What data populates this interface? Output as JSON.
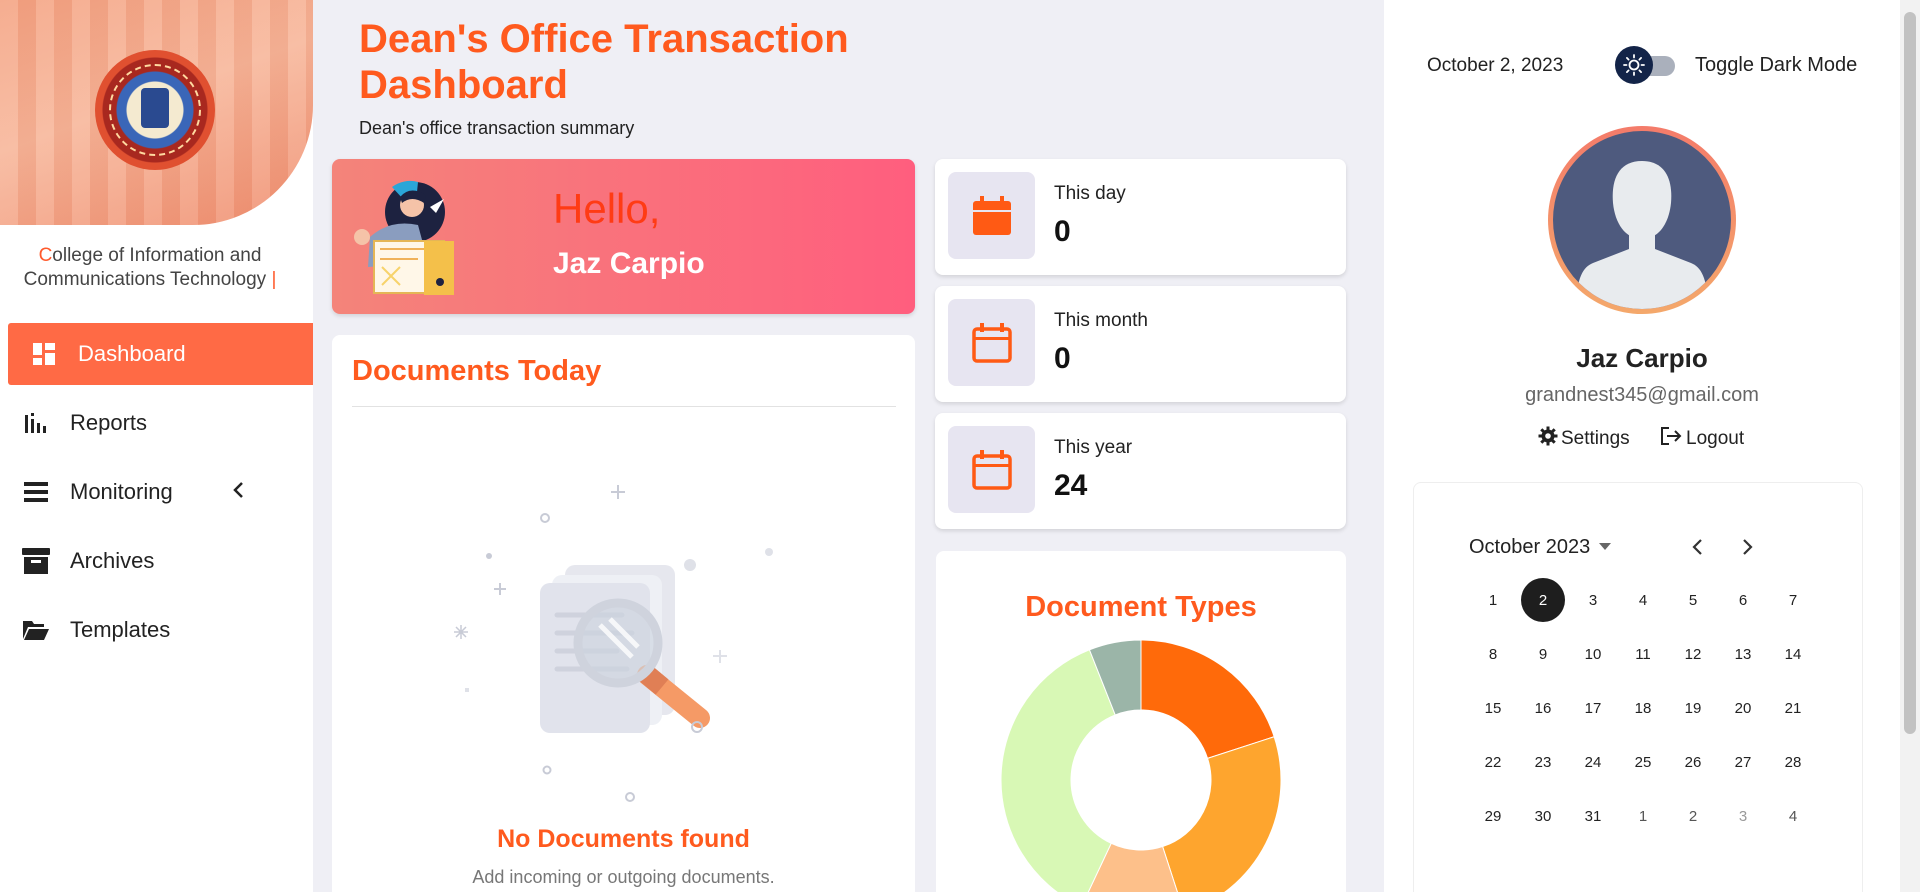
{
  "sidebar": {
    "college_first_letter": "C",
    "college_rest_line1": "ollege of Information and",
    "college_line2": "Communications Technology",
    "caret": "|",
    "nav": [
      {
        "label": "Dashboard",
        "icon": "dashboard-icon",
        "active": true
      },
      {
        "label": "Reports",
        "icon": "bar-chart-icon"
      },
      {
        "label": "Monitoring",
        "icon": "list-icon"
      },
      {
        "label": "Archives",
        "icon": "archive-icon"
      },
      {
        "label": "Templates",
        "icon": "folder-open-icon"
      }
    ]
  },
  "header": {
    "title": "Dean's Office Transaction Dashboard",
    "subtitle": "Dean's office transaction summary"
  },
  "hello": {
    "greeting": "Hello,",
    "name": "Jaz Carpio"
  },
  "documents_today": {
    "title": "Documents Today",
    "empty_title": "No Documents found",
    "empty_subtitle": "Add incoming or outgoing documents."
  },
  "stats": [
    {
      "label": "This day",
      "value": "0"
    },
    {
      "label": "This month",
      "value": "0"
    },
    {
      "label": "This year",
      "value": "24"
    }
  ],
  "document_types": {
    "title": "Document Types"
  },
  "chart_data": {
    "type": "pie",
    "title": "Document Types",
    "donut": true,
    "slices": [
      {
        "value": 20,
        "color": "#ff6a0a"
      },
      {
        "value": 25,
        "color": "#fea52e"
      },
      {
        "value": 12,
        "color": "#fdc08a"
      },
      {
        "value": 37,
        "color": "#d8f8b5"
      },
      {
        "value": 6,
        "color": "#9bb5a8"
      }
    ]
  },
  "right_panel": {
    "date": "October 2, 2023",
    "toggle_label": "Toggle Dark Mode",
    "profile_name": "Jaz Carpio",
    "profile_email": "grandnest345@gmail.com",
    "settings_label": "Settings",
    "logout_label": "Logout"
  },
  "calendar": {
    "month_label": "October 2023",
    "selected_day": "2",
    "weeks": [
      [
        "1",
        "2",
        "3",
        "4",
        "5",
        "6",
        "7"
      ],
      [
        "8",
        "9",
        "10",
        "11",
        "12",
        "13",
        "14"
      ],
      [
        "15",
        "16",
        "17",
        "18",
        "19",
        "20",
        "21"
      ],
      [
        "22",
        "23",
        "24",
        "25",
        "26",
        "27",
        "28"
      ],
      [
        "29",
        "30",
        "31",
        "1",
        "2",
        "3",
        "4"
      ]
    ]
  },
  "colors": {
    "accent": "#ff5a1e",
    "active_nav": "#ff6a45",
    "hello_gradient_start": "#f4847a",
    "hello_gradient_end": "#ff5e7e"
  }
}
